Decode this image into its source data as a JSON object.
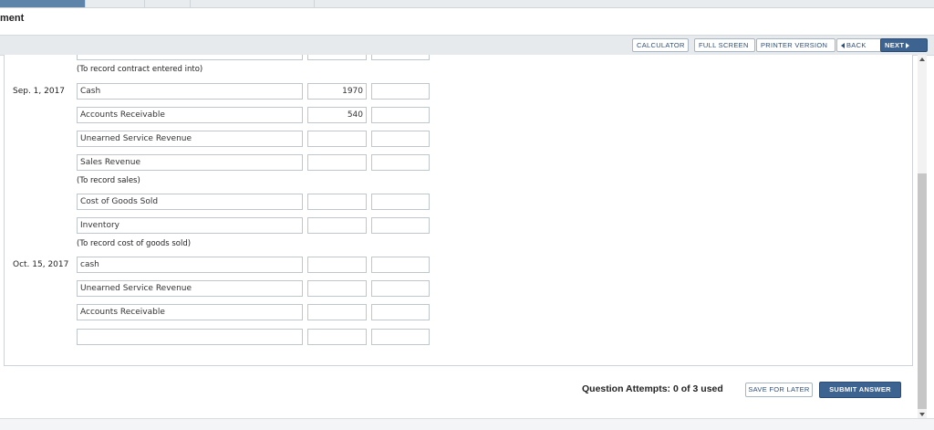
{
  "page": {
    "title": "ment"
  },
  "toolbar": {
    "calculator": "CALCULATOR",
    "full_screen": "FULL SCREEN",
    "printer_version": "PRINTER VERSION",
    "back": "BACK",
    "next": "NEXT"
  },
  "journal": {
    "top_note": "(To record contract entered into)",
    "sep_date": "Sep. 1, 2017",
    "sep_rows": [
      {
        "account": "Cash",
        "debit": "1970",
        "credit": ""
      },
      {
        "account": "Accounts Receivable",
        "debit": "540",
        "credit": ""
      },
      {
        "account": "Unearned Service Revenue",
        "debit": "",
        "credit": ""
      },
      {
        "account": "Sales Revenue",
        "debit": "",
        "credit": ""
      }
    ],
    "sales_note": "(To record sales)",
    "cogs_rows": [
      {
        "account": "Cost of Goods Sold",
        "debit": "",
        "credit": ""
      },
      {
        "account": "Inventory",
        "debit": "",
        "credit": ""
      }
    ],
    "cogs_note": "(To record cost of goods sold)",
    "oct_date": "Oct. 15, 2017",
    "oct_rows": [
      {
        "account": "cash",
        "debit": "",
        "credit": ""
      },
      {
        "account": "Unearned Service Revenue",
        "debit": "",
        "credit": ""
      },
      {
        "account": "Accounts Receivable",
        "debit": "",
        "credit": ""
      },
      {
        "account": "",
        "debit": "",
        "credit": ""
      }
    ]
  },
  "footer": {
    "attempts": "Question Attempts: 0 of 3 used",
    "save_for_later": "SAVE FOR LATER",
    "submit_answer": "SUBMIT ANSWER"
  }
}
